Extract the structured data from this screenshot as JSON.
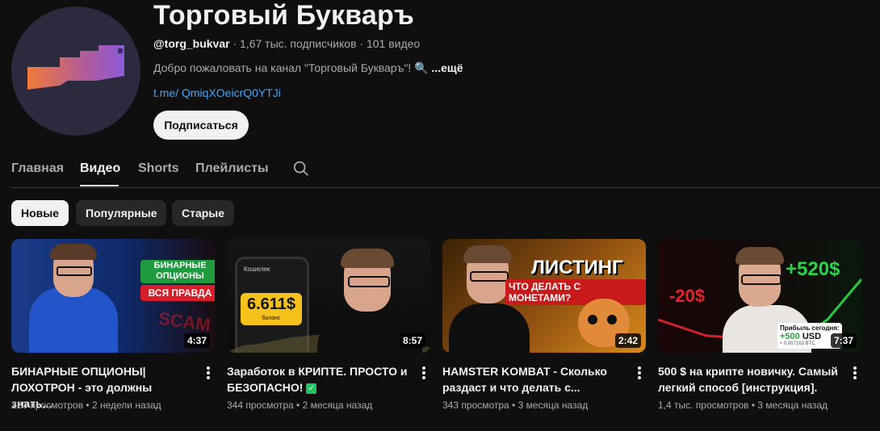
{
  "channel": {
    "name": "Торговый Букваръ",
    "handle": "@torg_bukvar",
    "sep1": " · ",
    "subscribers": "1,67 тыс. подписчиков",
    "sep2": " · ",
    "videos": "101 видео",
    "description": "Добро пожаловать на канал \"Торговый Букваръ\"! 🔍 ",
    "more": "...ещё",
    "link": "t.me/ QmiqXOeicrQ0YTJi",
    "subscribe_label": "Подписаться"
  },
  "tabs": [
    {
      "label": "Главная",
      "active": false
    },
    {
      "label": "Видео",
      "active": true
    },
    {
      "label": "Shorts",
      "active": false
    },
    {
      "label": "Плейлисты",
      "active": false
    }
  ],
  "chips": [
    {
      "label": "Новые",
      "active": true
    },
    {
      "label": "Популярные",
      "active": false
    },
    {
      "label": "Старые",
      "active": false
    }
  ],
  "videos": [
    {
      "title": "БИНАРНЫЕ ОПЦИОНЫ| ЛОХОТРОН - это должны знать...",
      "views": "220 просмотров",
      "sep": " • ",
      "age": "2 недели назад",
      "duration": "4:37",
      "thumb": {
        "line1": "БИНАРНЫЕ",
        "line2": "ОПЦИОНЫ",
        "line3": "ВСЯ ПРАВДА",
        "bg": "SCAM"
      }
    },
    {
      "title": "Заработок в КРИПТЕ. ПРОСТО и БЕЗОПАСНО!",
      "views": "344 просмотра",
      "sep": " • ",
      "age": "2 месяца назад",
      "duration": "8:57",
      "thumb": {
        "wallet": "Кошелек",
        "amount": "6.611$",
        "balance": "баланс"
      }
    },
    {
      "title": "HAMSTER KOMBAT - Сколько раздаст и что делать с...",
      "views": "343 просмотра",
      "sep": " • ",
      "age": "3 месяца назад",
      "duration": "2:42",
      "thumb": {
        "line1": "ЛИСТИНГ",
        "line2": "ЧТО ДЕЛАТЬ С МОНЕТАМИ?"
      }
    },
    {
      "title": "500 $ на крипте новичку. Самый легкий способ [инструкция].",
      "views": "1,4 тыс. просмотров",
      "sep": " • ",
      "age": "3 месяца назад",
      "duration": "7:37",
      "thumb": {
        "plus": "+520$",
        "minus": "-20$",
        "profit_label": "Прибыль сегодня:",
        "profit_value": "+500",
        "profit_unit": "USD",
        "profit_btc": "≈ 0.007163 BTC"
      }
    }
  ],
  "colors": {
    "accent_link": "#3ea6ff",
    "badge_green": "#21c45d"
  }
}
